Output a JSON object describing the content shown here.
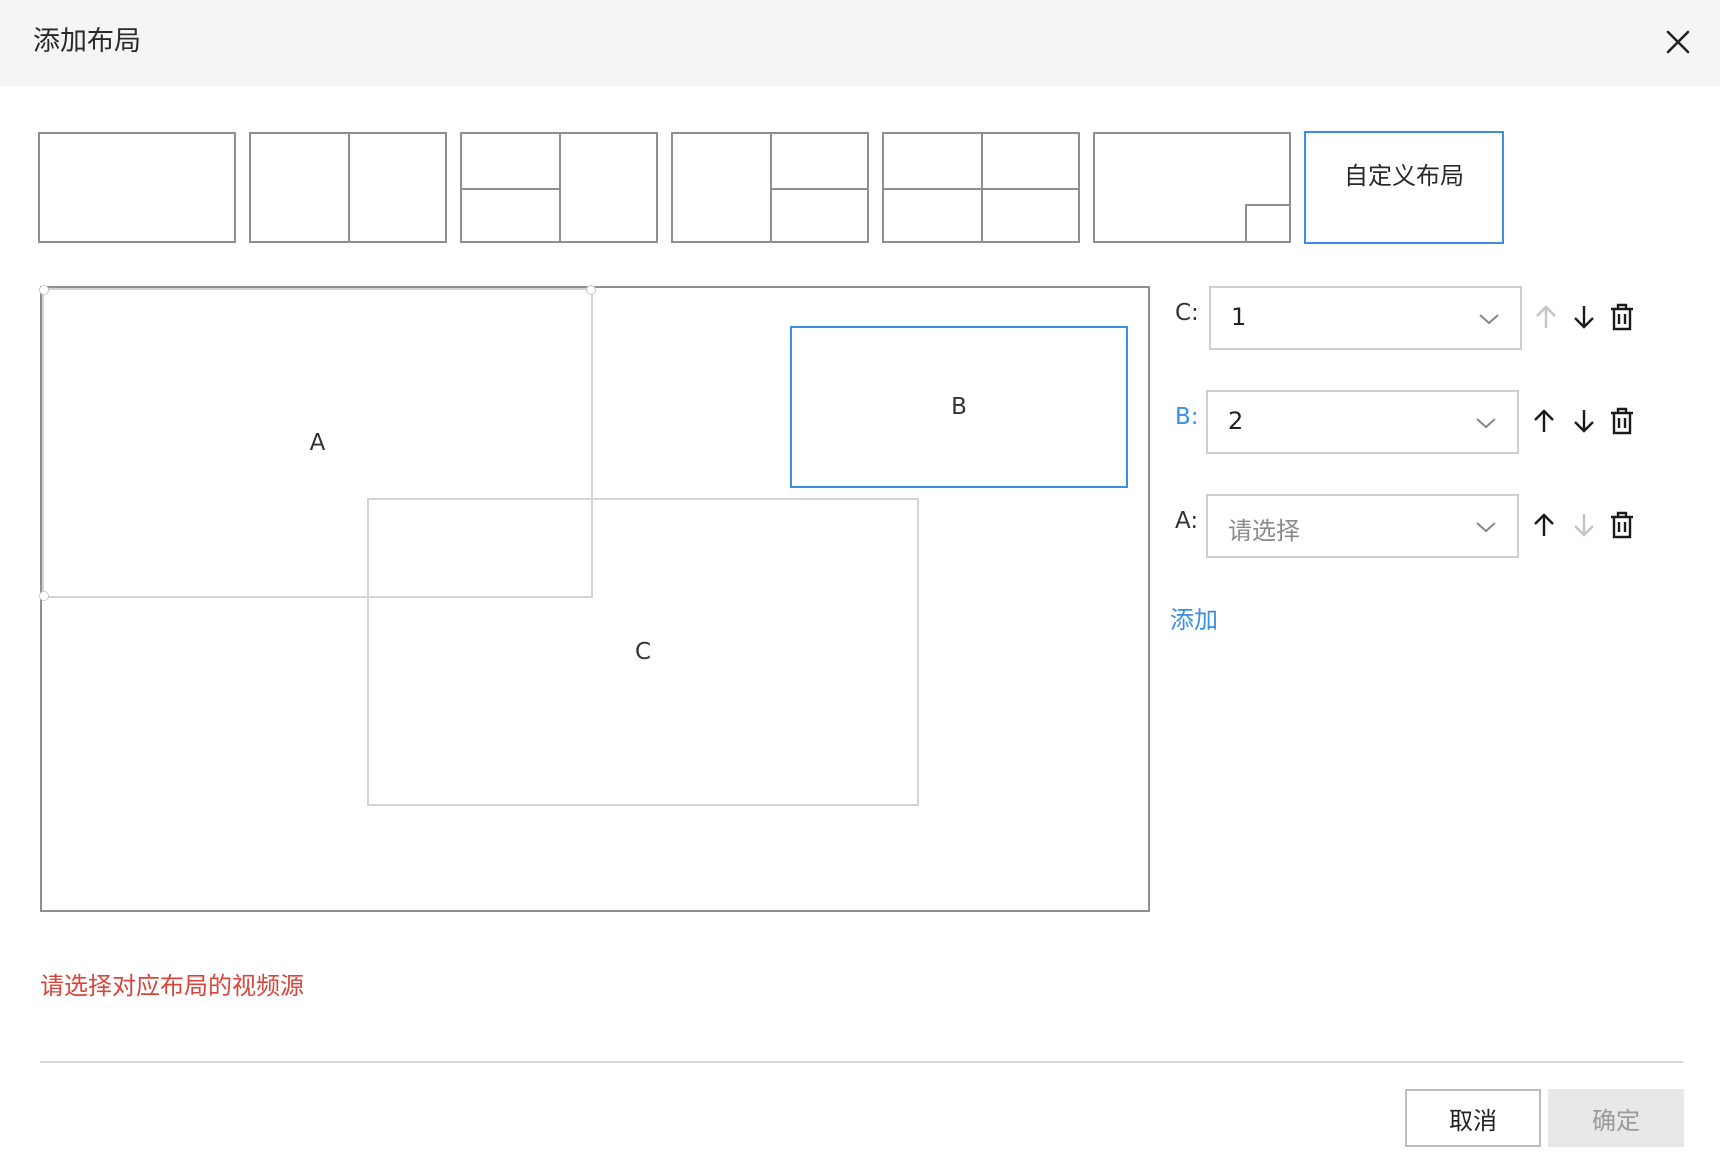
{
  "dialog": {
    "title": "添加布局"
  },
  "presets": {
    "custom_label": "自定义布局",
    "names": [
      "single",
      "two-columns",
      "left-split-right-full",
      "left-full-right-split",
      "four-grid",
      "picture-in-picture",
      "custom"
    ]
  },
  "canvas": {
    "regions": [
      {
        "label": "A"
      },
      {
        "label": "B"
      },
      {
        "label": "C"
      }
    ]
  },
  "layers": [
    {
      "label": "C:",
      "value": "1",
      "placeholder": "",
      "up_enabled": false,
      "down_enabled": true,
      "active": false
    },
    {
      "label": "B:",
      "value": "2",
      "placeholder": "",
      "up_enabled": true,
      "down_enabled": true,
      "active": true
    },
    {
      "label": "A:",
      "value": "",
      "placeholder": "请选择",
      "up_enabled": true,
      "down_enabled": false,
      "active": false
    }
  ],
  "add_label": "添加",
  "warning": "请选择对应布局的视频源",
  "footer": {
    "cancel_label": "取消",
    "ok_label": "确定"
  },
  "colors": {
    "accent": "#3a8ee6",
    "warning": "#d9453b",
    "header_bg": "#f5f5f5",
    "disabled_bg": "#e8e8e8"
  }
}
